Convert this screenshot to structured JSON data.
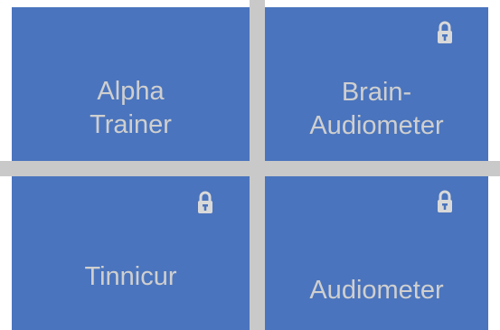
{
  "colors": {
    "tile_bg": "#4a74bd",
    "tile_text": "#cfcfcf",
    "divider": "#c9c9c9",
    "lock": "#d9d9d9"
  },
  "tiles": [
    {
      "line1": "Alpha",
      "line2": "Trainer",
      "locked": false,
      "icon": null
    },
    {
      "line1": "Brain-",
      "line2": "Audiometer",
      "locked": true,
      "icon": "lock-icon"
    },
    {
      "line1": "Tinnicur",
      "locked": true,
      "icon": "lock-icon"
    },
    {
      "line1": "Audiometer",
      "locked": true,
      "icon": "lock-icon"
    }
  ]
}
